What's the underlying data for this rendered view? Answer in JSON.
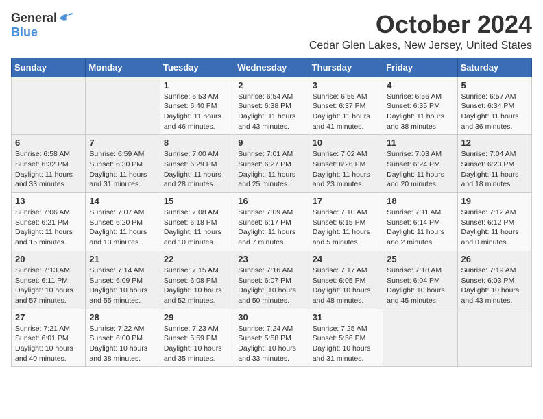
{
  "logo": {
    "general": "General",
    "blue": "Blue"
  },
  "title": "October 2024",
  "location": "Cedar Glen Lakes, New Jersey, United States",
  "days_of_week": [
    "Sunday",
    "Monday",
    "Tuesday",
    "Wednesday",
    "Thursday",
    "Friday",
    "Saturday"
  ],
  "weeks": [
    [
      {
        "day": "",
        "info": ""
      },
      {
        "day": "",
        "info": ""
      },
      {
        "day": "1",
        "info": "Sunrise: 6:53 AM\nSunset: 6:40 PM\nDaylight: 11 hours and 46 minutes."
      },
      {
        "day": "2",
        "info": "Sunrise: 6:54 AM\nSunset: 6:38 PM\nDaylight: 11 hours and 43 minutes."
      },
      {
        "day": "3",
        "info": "Sunrise: 6:55 AM\nSunset: 6:37 PM\nDaylight: 11 hours and 41 minutes."
      },
      {
        "day": "4",
        "info": "Sunrise: 6:56 AM\nSunset: 6:35 PM\nDaylight: 11 hours and 38 minutes."
      },
      {
        "day": "5",
        "info": "Sunrise: 6:57 AM\nSunset: 6:34 PM\nDaylight: 11 hours and 36 minutes."
      }
    ],
    [
      {
        "day": "6",
        "info": "Sunrise: 6:58 AM\nSunset: 6:32 PM\nDaylight: 11 hours and 33 minutes."
      },
      {
        "day": "7",
        "info": "Sunrise: 6:59 AM\nSunset: 6:30 PM\nDaylight: 11 hours and 31 minutes."
      },
      {
        "day": "8",
        "info": "Sunrise: 7:00 AM\nSunset: 6:29 PM\nDaylight: 11 hours and 28 minutes."
      },
      {
        "day": "9",
        "info": "Sunrise: 7:01 AM\nSunset: 6:27 PM\nDaylight: 11 hours and 25 minutes."
      },
      {
        "day": "10",
        "info": "Sunrise: 7:02 AM\nSunset: 6:26 PM\nDaylight: 11 hours and 23 minutes."
      },
      {
        "day": "11",
        "info": "Sunrise: 7:03 AM\nSunset: 6:24 PM\nDaylight: 11 hours and 20 minutes."
      },
      {
        "day": "12",
        "info": "Sunrise: 7:04 AM\nSunset: 6:23 PM\nDaylight: 11 hours and 18 minutes."
      }
    ],
    [
      {
        "day": "13",
        "info": "Sunrise: 7:06 AM\nSunset: 6:21 PM\nDaylight: 11 hours and 15 minutes."
      },
      {
        "day": "14",
        "info": "Sunrise: 7:07 AM\nSunset: 6:20 PM\nDaylight: 11 hours and 13 minutes."
      },
      {
        "day": "15",
        "info": "Sunrise: 7:08 AM\nSunset: 6:18 PM\nDaylight: 11 hours and 10 minutes."
      },
      {
        "day": "16",
        "info": "Sunrise: 7:09 AM\nSunset: 6:17 PM\nDaylight: 11 hours and 7 minutes."
      },
      {
        "day": "17",
        "info": "Sunrise: 7:10 AM\nSunset: 6:15 PM\nDaylight: 11 hours and 5 minutes."
      },
      {
        "day": "18",
        "info": "Sunrise: 7:11 AM\nSunset: 6:14 PM\nDaylight: 11 hours and 2 minutes."
      },
      {
        "day": "19",
        "info": "Sunrise: 7:12 AM\nSunset: 6:12 PM\nDaylight: 11 hours and 0 minutes."
      }
    ],
    [
      {
        "day": "20",
        "info": "Sunrise: 7:13 AM\nSunset: 6:11 PM\nDaylight: 10 hours and 57 minutes."
      },
      {
        "day": "21",
        "info": "Sunrise: 7:14 AM\nSunset: 6:09 PM\nDaylight: 10 hours and 55 minutes."
      },
      {
        "day": "22",
        "info": "Sunrise: 7:15 AM\nSunset: 6:08 PM\nDaylight: 10 hours and 52 minutes."
      },
      {
        "day": "23",
        "info": "Sunrise: 7:16 AM\nSunset: 6:07 PM\nDaylight: 10 hours and 50 minutes."
      },
      {
        "day": "24",
        "info": "Sunrise: 7:17 AM\nSunset: 6:05 PM\nDaylight: 10 hours and 48 minutes."
      },
      {
        "day": "25",
        "info": "Sunrise: 7:18 AM\nSunset: 6:04 PM\nDaylight: 10 hours and 45 minutes."
      },
      {
        "day": "26",
        "info": "Sunrise: 7:19 AM\nSunset: 6:03 PM\nDaylight: 10 hours and 43 minutes."
      }
    ],
    [
      {
        "day": "27",
        "info": "Sunrise: 7:21 AM\nSunset: 6:01 PM\nDaylight: 10 hours and 40 minutes."
      },
      {
        "day": "28",
        "info": "Sunrise: 7:22 AM\nSunset: 6:00 PM\nDaylight: 10 hours and 38 minutes."
      },
      {
        "day": "29",
        "info": "Sunrise: 7:23 AM\nSunset: 5:59 PM\nDaylight: 10 hours and 35 minutes."
      },
      {
        "day": "30",
        "info": "Sunrise: 7:24 AM\nSunset: 5:58 PM\nDaylight: 10 hours and 33 minutes."
      },
      {
        "day": "31",
        "info": "Sunrise: 7:25 AM\nSunset: 5:56 PM\nDaylight: 10 hours and 31 minutes."
      },
      {
        "day": "",
        "info": ""
      },
      {
        "day": "",
        "info": ""
      }
    ]
  ]
}
